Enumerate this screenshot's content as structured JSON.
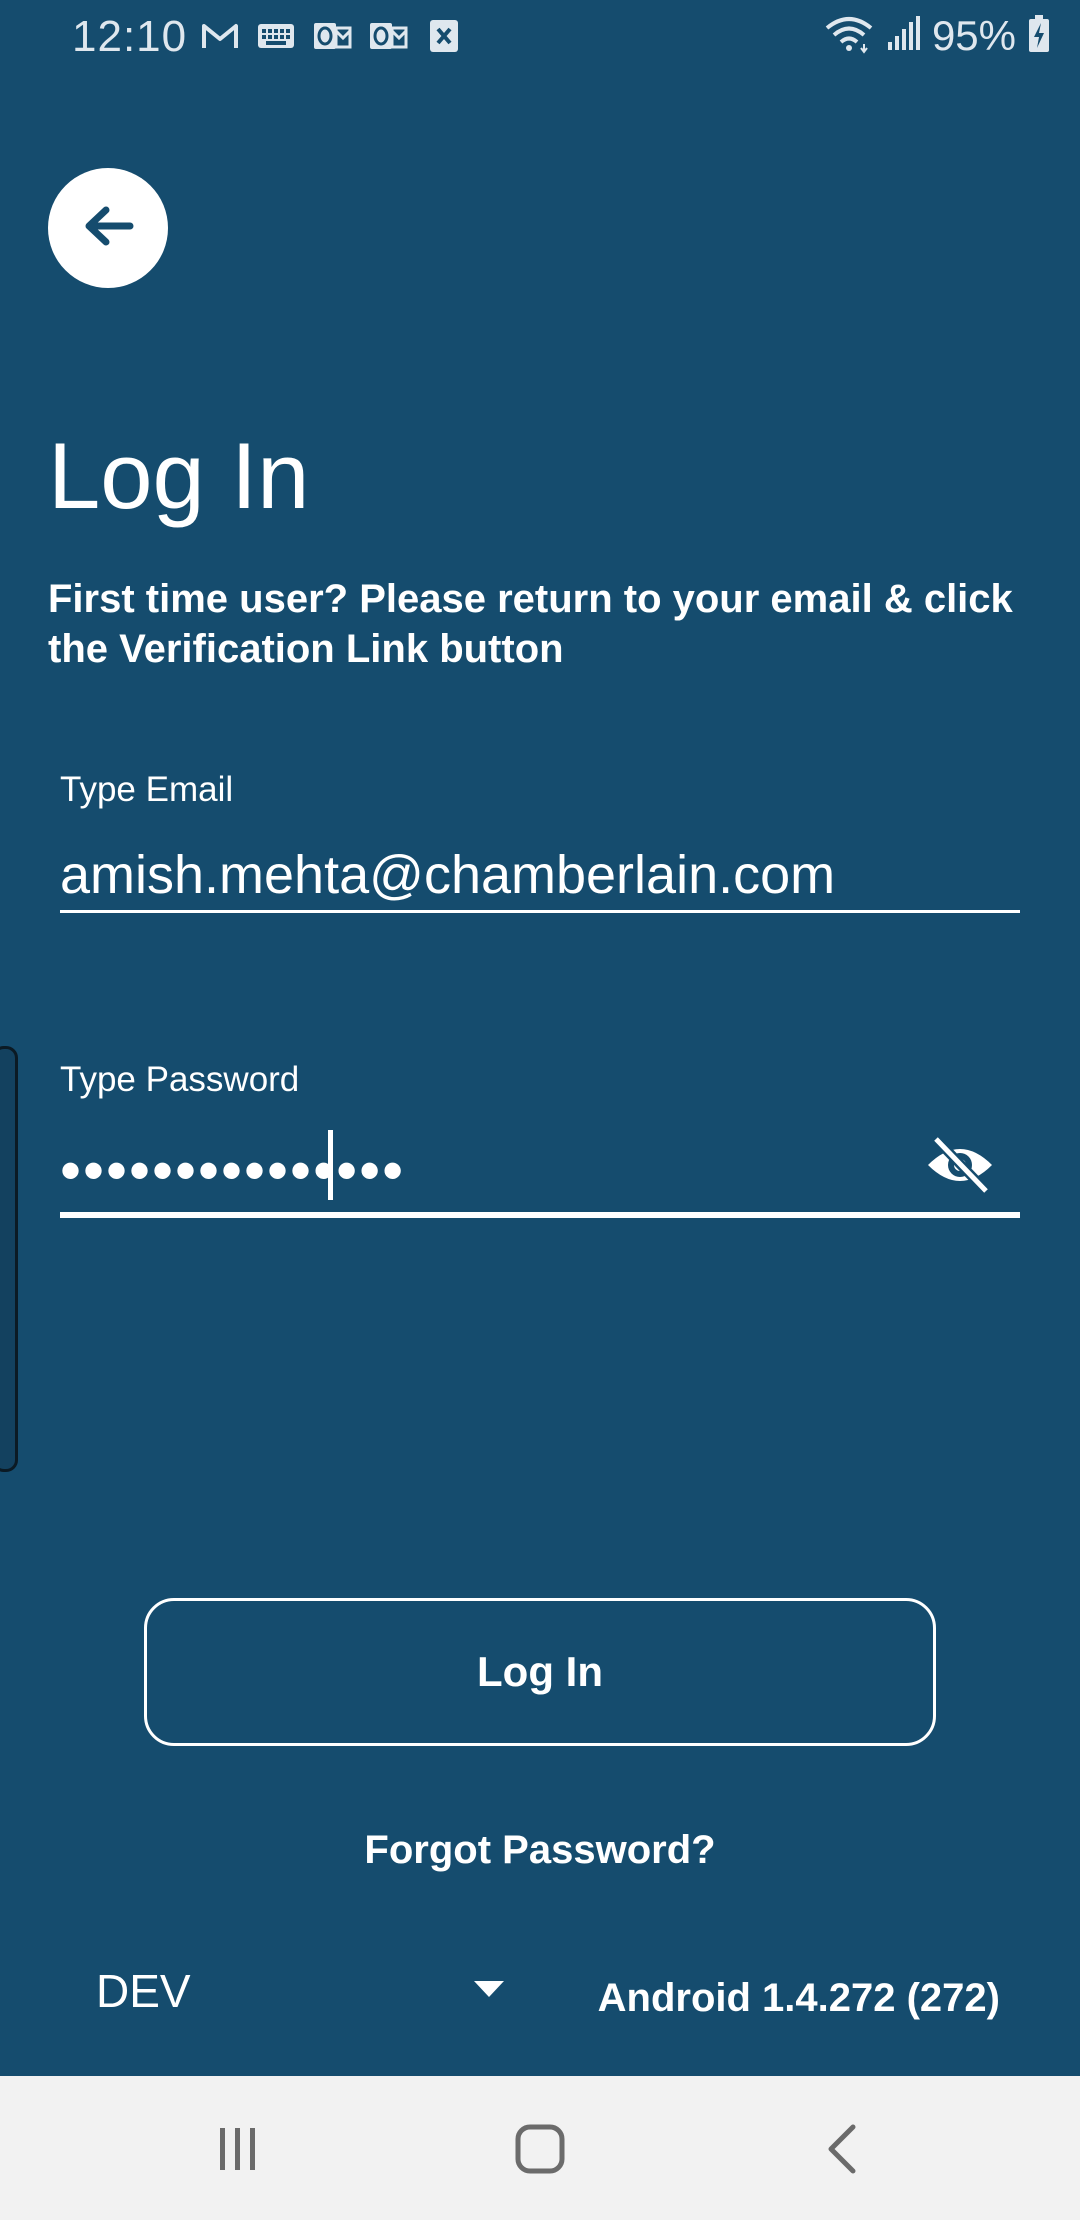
{
  "status_bar": {
    "time": "12:10",
    "battery_pct": "95%",
    "notification_icons": [
      "gmail-icon",
      "keyboard-icon",
      "outlook-icon",
      "outlook-icon",
      "excel-icon"
    ],
    "system_icons": [
      "wifi-icon",
      "signal-icon",
      "battery-charging-icon"
    ]
  },
  "header": {
    "back_icon": "arrow-left-icon",
    "title": "Log In",
    "subtitle": "First time user? Please return to your email & click the Verification Link button"
  },
  "form": {
    "email": {
      "label": "Type Email",
      "value": "amish.mehta@chamberlain.com"
    },
    "password": {
      "label": "Type Password",
      "masked_value": "•••••••••••••••",
      "toggle_icon": "eye-off-icon"
    }
  },
  "actions": {
    "login_label": "Log In",
    "forgot_label": "Forgot Password?"
  },
  "footer": {
    "environment": "DEV",
    "version": "Android 1.4.272 (272)"
  },
  "colors": {
    "background": "#154c6e",
    "text": "#ffffff",
    "nav_bar": "#f2f2f2",
    "nav_icon": "#6b6b6b"
  }
}
